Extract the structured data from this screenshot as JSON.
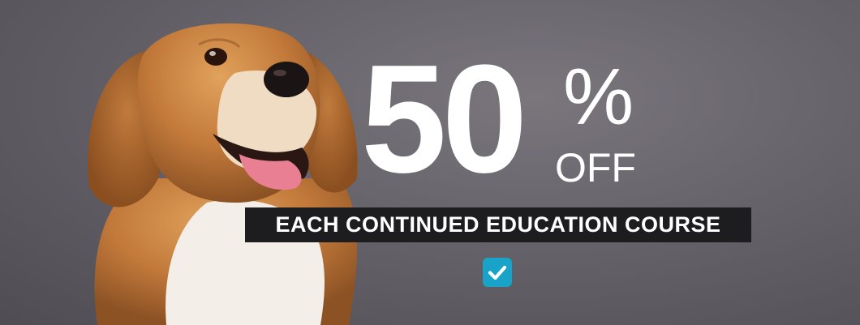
{
  "promo": {
    "number": "50",
    "percent_sign": "%",
    "off_label": "OFF",
    "tagline": "EACH CONTINUED EDUCATION COURSE"
  },
  "image": {
    "subject": "dog"
  },
  "icons": {
    "checkbox": "check-icon"
  },
  "colors": {
    "background": "#66626a",
    "text": "#ffffff",
    "tagline_bg": "#1d1c1f",
    "check_bg": "#1aa3c9"
  }
}
